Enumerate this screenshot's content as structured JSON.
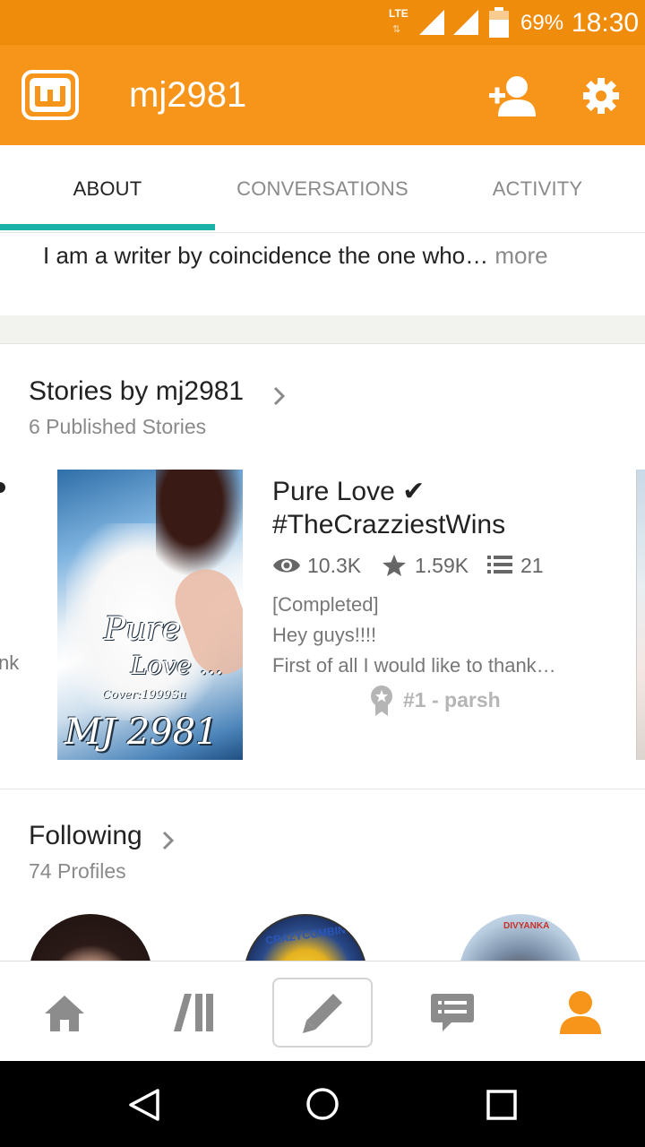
{
  "status_bar": {
    "network": "LTE",
    "battery": "69%",
    "time": "18:30"
  },
  "app_bar": {
    "logo": "w",
    "title": "mj2981",
    "icons": [
      "add-user-icon",
      "gear-icon"
    ]
  },
  "tabs": [
    {
      "label": "ABOUT",
      "active": true
    },
    {
      "label": "CONVERSATIONS",
      "active": false
    },
    {
      "label": "ACTIVITY",
      "active": false
    }
  ],
  "about": {
    "text": "I am a writer by coincidence the one who…",
    "more_label": "more"
  },
  "stories": {
    "title": "Stories by mj2981",
    "subtitle": "6 Published Stories",
    "left_edge_text": "nk",
    "items": [
      {
        "cover": {
          "line1": "Pure",
          "line2": "Love ...",
          "line3": "Cover:1999Su",
          "line4": "MJ 2981"
        },
        "title_line1": "Pure Love ✔",
        "title_line2": "#TheCrazziestWins",
        "reads": "10.3K",
        "votes": "1.59K",
        "parts": "21",
        "desc_line1": "[Completed]",
        "desc_line2": "Hey guys!!!!",
        "desc_line3": "First of all I would like to thank…",
        "rank": "#1 - parsh"
      }
    ]
  },
  "following": {
    "title": "Following",
    "subtitle": "74 Profiles",
    "avatar_labels": [
      "CRAZYCOMBINE",
      "DIVYANKA"
    ]
  },
  "bottom_nav": [
    "home-icon",
    "library-icon",
    "write-icon",
    "messages-icon",
    "profile-icon"
  ],
  "colors": {
    "status_bar": "#f08c0c",
    "app_bar": "#f7951a",
    "tab_indicator": "#1ab1a8",
    "active_nav": "#f7951a",
    "inactive_nav": "#8c8c8c"
  }
}
